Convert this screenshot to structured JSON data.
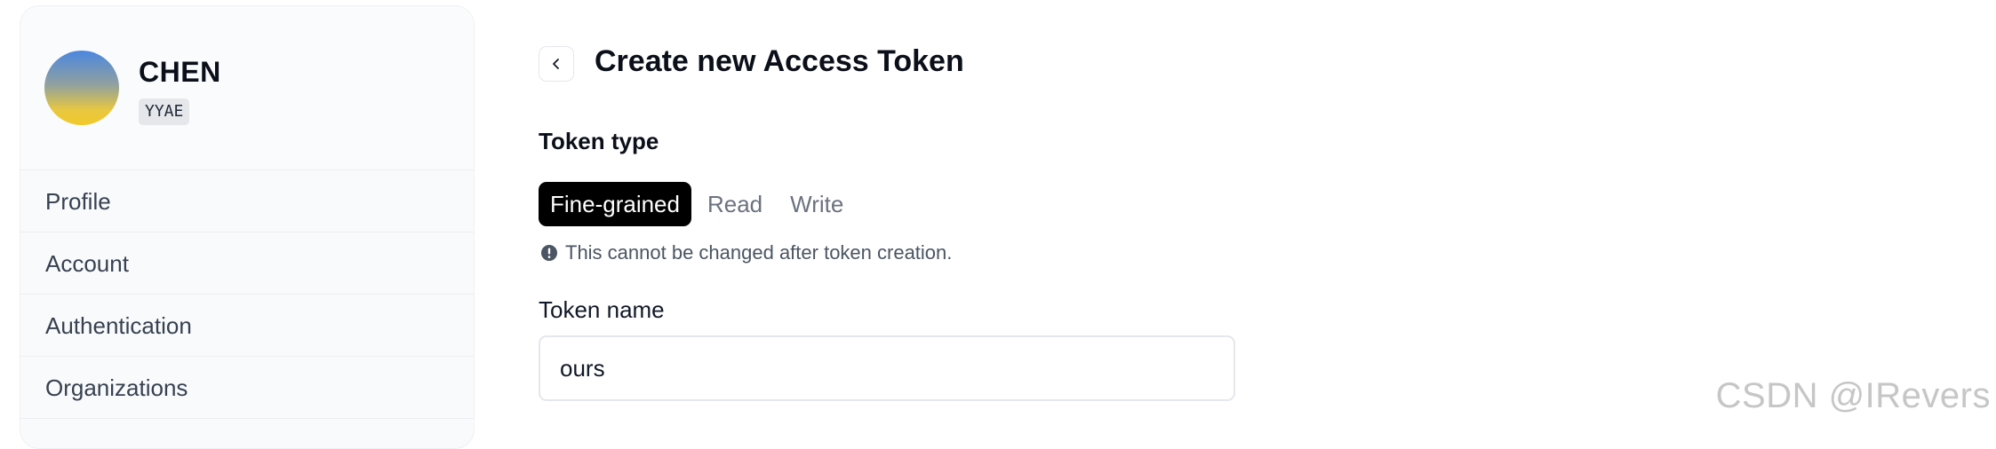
{
  "user": {
    "name": "CHEN",
    "handle": "YYAE"
  },
  "sidebar": {
    "items": [
      {
        "label": "Profile"
      },
      {
        "label": "Account"
      },
      {
        "label": "Authentication"
      },
      {
        "label": "Organizations"
      }
    ]
  },
  "main": {
    "title": "Create new Access Token",
    "token_type": {
      "label": "Token type",
      "options": [
        {
          "label": "Fine-grained",
          "selected": true
        },
        {
          "label": "Read",
          "selected": false
        },
        {
          "label": "Write",
          "selected": false
        }
      ],
      "note": "This cannot be changed after token creation."
    },
    "token_name": {
      "label": "Token name",
      "value": "ours"
    }
  },
  "watermark": "CSDN @IRevers",
  "icons": {
    "back": "chevron-left-icon",
    "note": "exclamation-circle-icon"
  },
  "colors": {
    "selected_tab_bg": "#000000",
    "selected_tab_text": "#ffffff"
  }
}
